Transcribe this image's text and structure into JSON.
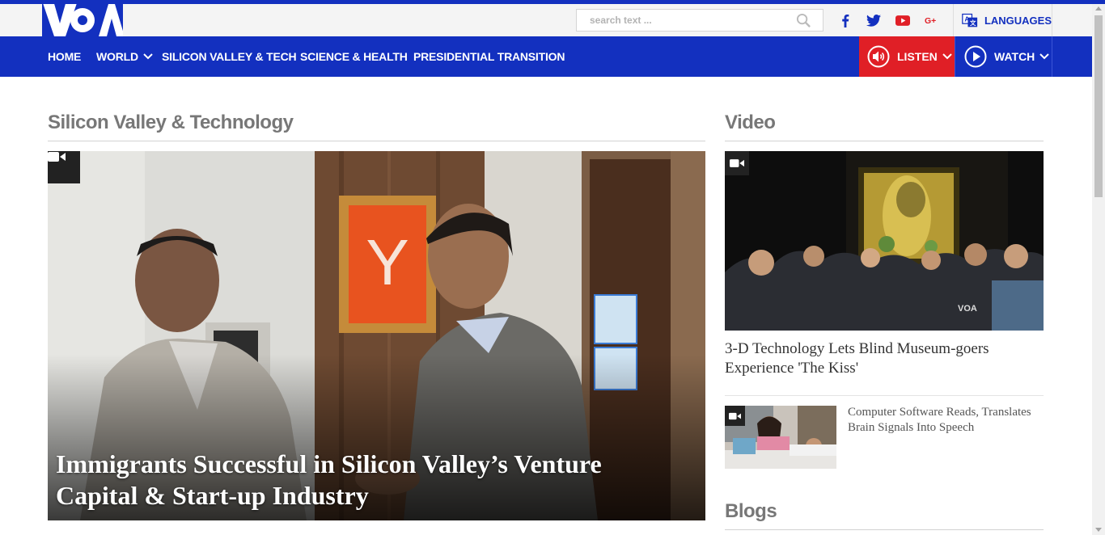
{
  "header": {
    "logo_text": "VOA",
    "search": {
      "placeholder": "search text ..."
    },
    "social": [
      "facebook-icon",
      "twitter-icon",
      "youtube-icon",
      "google-plus-icon"
    ],
    "languages_label": "LANGUAGES"
  },
  "nav": {
    "items": [
      {
        "label": "HOME"
      },
      {
        "label": "WORLD",
        "has_dropdown": true
      },
      {
        "label": "SILICON VALLEY & TECH"
      },
      {
        "label": "SCIENCE & HEALTH"
      },
      {
        "label": "PRESIDENTIAL TRANSITION"
      }
    ],
    "listen_label": "LISTEN",
    "watch_label": "WATCH"
  },
  "colors": {
    "brand_blue": "#1330bf",
    "listen_red": "#e01f26"
  },
  "main": {
    "section_title": "Silicon Valley & Technology",
    "hero": {
      "title": "Immigrants Successful in Silicon Valley’s Venture Capital & Start-up Industry",
      "badge": "video-camera-icon"
    }
  },
  "sidebar": {
    "video_title": "Video",
    "featured_video": {
      "title": "3-D Technology Lets Blind Museum-goers Experience 'The Kiss'"
    },
    "video_items": [
      {
        "title": "Computer Software Reads, Translates Brain Signals Into Speech"
      }
    ],
    "blogs_title": "Blogs"
  }
}
